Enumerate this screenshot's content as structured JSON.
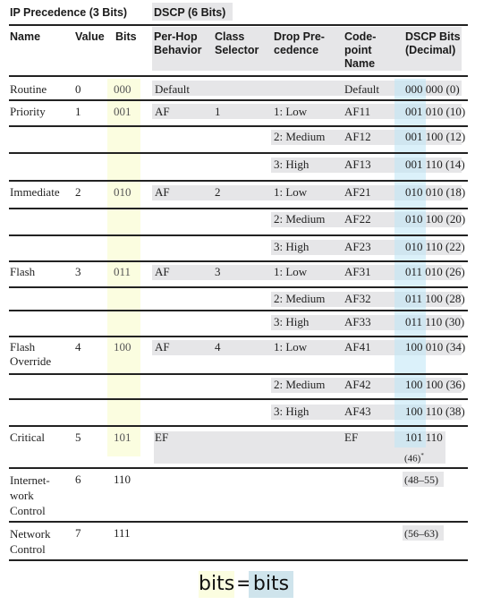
{
  "header": {
    "group_ip": "IP Precedence (3 Bits)",
    "group_dscp": "DSCP (6 Bits)",
    "col_name": "Name",
    "col_value": "Value",
    "col_bits": "Bits",
    "col_phb_1": "Per-Hop",
    "col_phb_2": "Behavior",
    "col_cs_1": "Class",
    "col_cs_2": "Selector",
    "col_drop_1": "Drop Pre-",
    "col_drop_2": "cedence",
    "col_cp_1": "Code-",
    "col_cp_2": "point",
    "col_cp_3": "Name",
    "col_dscp_1": "DSCP Bits",
    "col_dscp_2": "(Decimal)"
  },
  "rows": [
    {
      "name": "Routine",
      "value": "0",
      "bits": "000",
      "phb": "Default",
      "cs": "",
      "drop": "",
      "codepoint": "Default",
      "dscp": "000 000 (0)"
    },
    {
      "name": "Priority",
      "value": "1",
      "bits": "001",
      "phb": "AF",
      "cs": "1",
      "drop": "1: Low",
      "codepoint": "AF11",
      "dscp": "001 010 (10)"
    },
    {
      "name": "",
      "value": "",
      "bits": "",
      "phb": "",
      "cs": "",
      "drop": "2: Medium",
      "codepoint": "AF12",
      "dscp": "001 100 (12)"
    },
    {
      "name": "",
      "value": "",
      "bits": "",
      "phb": "",
      "cs": "",
      "drop": "3: High",
      "codepoint": "AF13",
      "dscp": "001 110 (14)"
    },
    {
      "name": "Immediate",
      "value": "2",
      "bits": "010",
      "phb": "AF",
      "cs": "2",
      "drop": "1: Low",
      "codepoint": "AF21",
      "dscp": "010 010 (18)"
    },
    {
      "name": "",
      "value": "",
      "bits": "",
      "phb": "",
      "cs": "",
      "drop": "2: Medium",
      "codepoint": "AF22",
      "dscp": "010 100 (20)"
    },
    {
      "name": "",
      "value": "",
      "bits": "",
      "phb": "",
      "cs": "",
      "drop": "3: High",
      "codepoint": "AF23",
      "dscp": "010 110 (22)"
    },
    {
      "name": "Flash",
      "value": "3",
      "bits": "011",
      "phb": "AF",
      "cs": "3",
      "drop": "1: Low",
      "codepoint": "AF31",
      "dscp": "011 010 (26)"
    },
    {
      "name": "",
      "value": "",
      "bits": "",
      "phb": "",
      "cs": "",
      "drop": "2: Medium",
      "codepoint": "AF32",
      "dscp": "011 100 (28)"
    },
    {
      "name": "",
      "value": "",
      "bits": "",
      "phb": "",
      "cs": "",
      "drop": "3: High",
      "codepoint": "AF33",
      "dscp": "011 110 (30)"
    },
    {
      "name_1": "Flash",
      "name_2": "Override",
      "value": "4",
      "bits": "100",
      "phb": "AF",
      "cs": "4",
      "drop": "1: Low",
      "codepoint": "AF41",
      "dscp": "100 010 (34)"
    },
    {
      "name": "",
      "value": "",
      "bits": "",
      "phb": "",
      "cs": "",
      "drop": "2: Medium",
      "codepoint": "AF42",
      "dscp": "100 100 (36)"
    },
    {
      "name": "",
      "value": "",
      "bits": "",
      "phb": "",
      "cs": "",
      "drop": "3: High",
      "codepoint": "AF43",
      "dscp": "100 110 (38)"
    },
    {
      "name": "Critical",
      "value": "5",
      "bits": "101",
      "phb": "EF",
      "cs": "",
      "drop": "",
      "codepoint": "EF",
      "dscp_1": "101 110",
      "dscp_2": "(46)",
      "footnote": "*"
    },
    {
      "name_1": "Internet-",
      "name_2": "work",
      "name_3": "Control",
      "value": "6",
      "bits": "110",
      "dscp": "(48–55)"
    },
    {
      "name_1": "Network",
      "name_2": "Control",
      "value": "7",
      "bits": "111",
      "dscp": "(56–63)"
    }
  ],
  "legend": {
    "left": "bits",
    "equals": "=",
    "right": "bits",
    "yellow": "#fbfde0",
    "blue": "#cfe4ec"
  },
  "colors": {
    "ip_bits_highlight": "#fbfde0",
    "dscp_bits_highlight": "#d6eef8",
    "gray_band": "#e6e6e8"
  }
}
